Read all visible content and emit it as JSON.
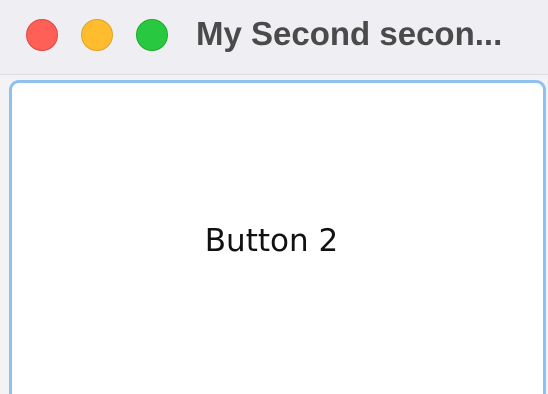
{
  "window": {
    "title": "My Second secon..."
  },
  "traffic_lights": {
    "close_color": "#fe5f57",
    "minimize_color": "#febc2e",
    "zoom_color": "#28c840"
  },
  "content": {
    "button_label": "Button 2"
  }
}
